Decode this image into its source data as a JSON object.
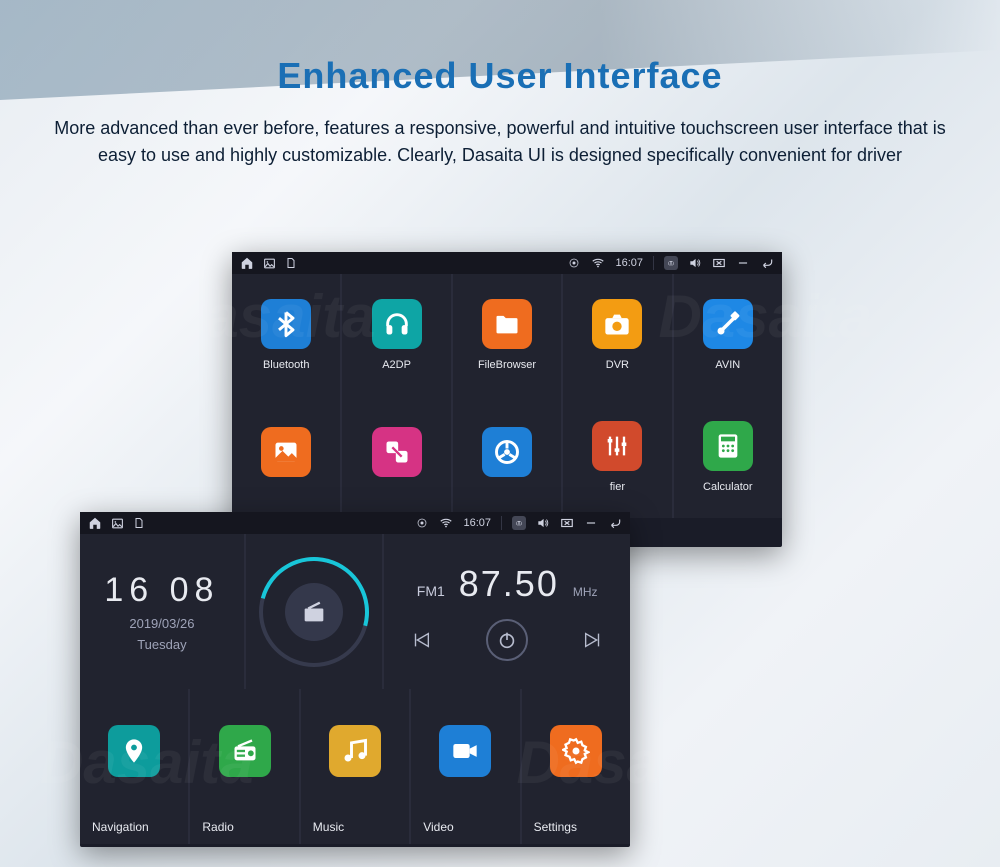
{
  "page": {
    "title": "Enhanced User Interface",
    "description": "More advanced than ever before, features a responsive, powerful and intuitive touchscreen user interface that is easy to use and highly customizable. Clearly, Dasaita UI is designed specifically convenient for driver"
  },
  "statusbar": {
    "time": "16:07"
  },
  "device1": {
    "row1": [
      {
        "label": "Bluetooth",
        "icon": "bluetooth",
        "color": "c-blue"
      },
      {
        "label": "A2DP",
        "icon": "headphones",
        "color": "c-teal"
      },
      {
        "label": "FileBrowser",
        "icon": "folder",
        "color": "c-orange"
      },
      {
        "label": "DVR",
        "icon": "camera",
        "color": "c-amber"
      },
      {
        "label": "AVIN",
        "icon": "cable",
        "color": "c-blue2"
      }
    ],
    "row2": [
      {
        "label": "",
        "icon": "gallery",
        "color": "c-orange"
      },
      {
        "label": "",
        "icon": "resize",
        "color": "c-pink"
      },
      {
        "label": "",
        "icon": "wheel",
        "color": "c-blue"
      },
      {
        "label": "fier",
        "icon": "sliders",
        "color": "c-red"
      },
      {
        "label": "Calculator",
        "icon": "calc",
        "color": "c-green"
      }
    ]
  },
  "device2": {
    "clock": {
      "time": "16 08",
      "date": "2019/03/26",
      "day": "Tuesday"
    },
    "radio": {
      "band": "FM1",
      "freq": "87.50",
      "unit": "MHz"
    },
    "tiles": [
      {
        "label": "Navigation",
        "icon": "pin",
        "color": "c-teal2"
      },
      {
        "label": "Radio",
        "icon": "radio",
        "color": "c-green"
      },
      {
        "label": "Music",
        "icon": "music",
        "color": "c-yellow"
      },
      {
        "label": "Video",
        "icon": "video",
        "color": "c-blue"
      },
      {
        "label": "Settings",
        "icon": "gear",
        "color": "c-orange"
      }
    ]
  }
}
